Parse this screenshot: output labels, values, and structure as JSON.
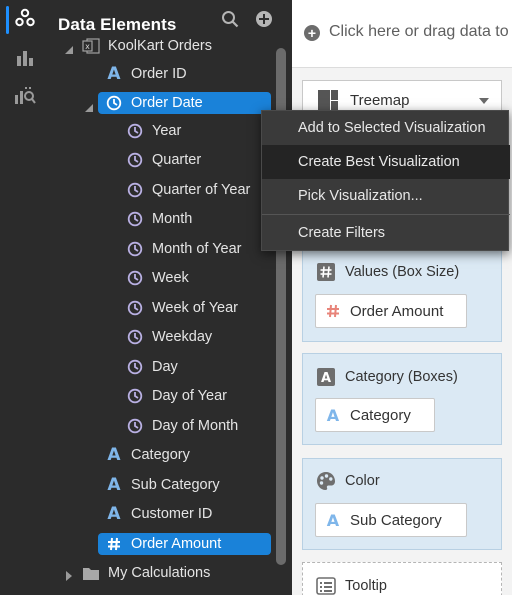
{
  "panel": {
    "title": "Data Elements",
    "tree": {
      "dataset": "KoolKart Orders",
      "order_id": "Order ID",
      "order_date": "Order Date",
      "date_parts": [
        "Year",
        "Quarter",
        "Quarter of Year",
        "Month",
        "Month of Year",
        "Week",
        "Week of Year",
        "Weekday",
        "Day",
        "Day of Year",
        "Day of Month"
      ],
      "category": "Category",
      "sub_category": "Sub Category",
      "customer_id": "Customer ID",
      "order_amount": "Order Amount",
      "my_calculations": "My Calculations"
    }
  },
  "canvas": {
    "drop_hint": "Click here or drag data to",
    "visualization_type": "Treemap",
    "values_box": {
      "title": "Values (Box Size)",
      "chip": "Order Amount"
    },
    "category_box": {
      "title": "Category (Boxes)",
      "chip": "Category"
    },
    "color_box": {
      "title": "Color",
      "chip": "Sub Category"
    },
    "tooltip_box": {
      "title": "Tooltip"
    }
  },
  "context_menu": {
    "items": [
      "Add to Selected Visualization",
      "Create Best Visualization",
      "Pick Visualization...",
      "Create Filters"
    ],
    "hovered_index": 1
  },
  "colors": {
    "selection": "#1a82d9",
    "attribute_icon": "#7fb6ea",
    "measure_icon": "#e8847a",
    "date_icon": "#b9b0e3"
  },
  "icons": {
    "rail": [
      "data-icon",
      "visualizations-icon",
      "analytics-icon"
    ],
    "panel": [
      "search-icon",
      "add-icon"
    ]
  }
}
